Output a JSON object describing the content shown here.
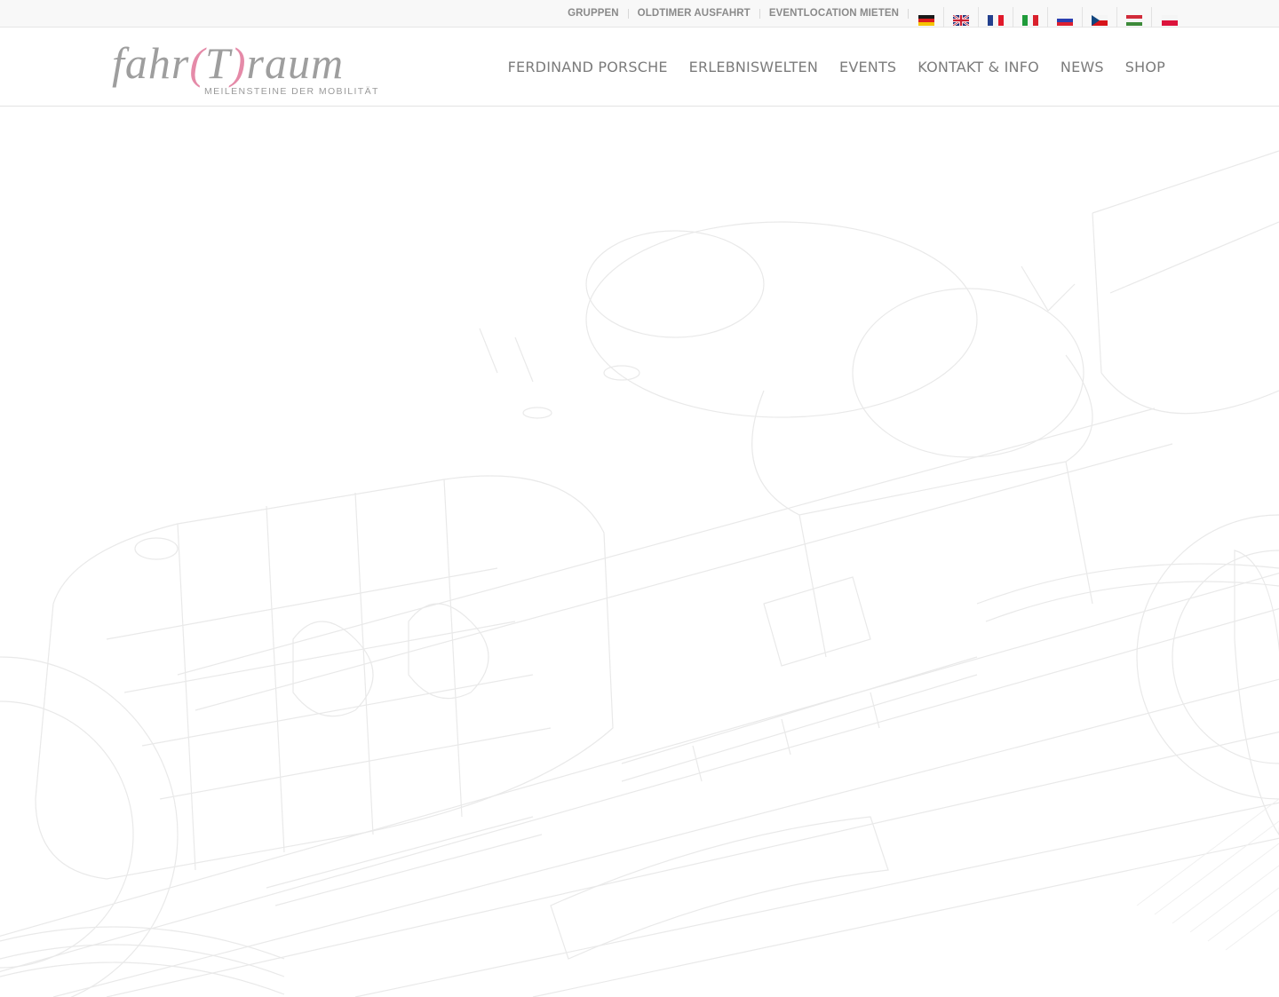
{
  "topbar": {
    "links": [
      "GRUPPEN",
      "OLDTIMER AUSFAHRT",
      "EVENTLOCATION MIETEN"
    ],
    "languages": [
      {
        "code": "de",
        "icon": "flag-germany-icon"
      },
      {
        "code": "en",
        "icon": "flag-uk-icon"
      },
      {
        "code": "fr",
        "icon": "flag-france-icon"
      },
      {
        "code": "it",
        "icon": "flag-italy-icon"
      },
      {
        "code": "ru",
        "icon": "flag-russia-icon"
      },
      {
        "code": "cz",
        "icon": "flag-czech-icon"
      },
      {
        "code": "hu",
        "icon": "flag-hungary-icon"
      },
      {
        "code": "pl",
        "icon": "flag-poland-icon"
      }
    ]
  },
  "header": {
    "logo": {
      "word_left": "fahr",
      "paren_open": "(",
      "letter": "T",
      "paren_close": ")",
      "word_right": "raum",
      "tagline": "MEILENSTEINE DER MOBILITÄT"
    },
    "nav": [
      "FERDINAND PORSCHE",
      "ERLEBNISWELTEN",
      "EVENTS",
      "KONTAKT & INFO",
      "NEWS",
      "SHOP"
    ]
  },
  "colors": {
    "accent_pink": "#e58aa8",
    "logo_gray": "#9e9e9e",
    "nav_text": "#7b7b7b",
    "topbar_bg": "#f8f8f8"
  }
}
